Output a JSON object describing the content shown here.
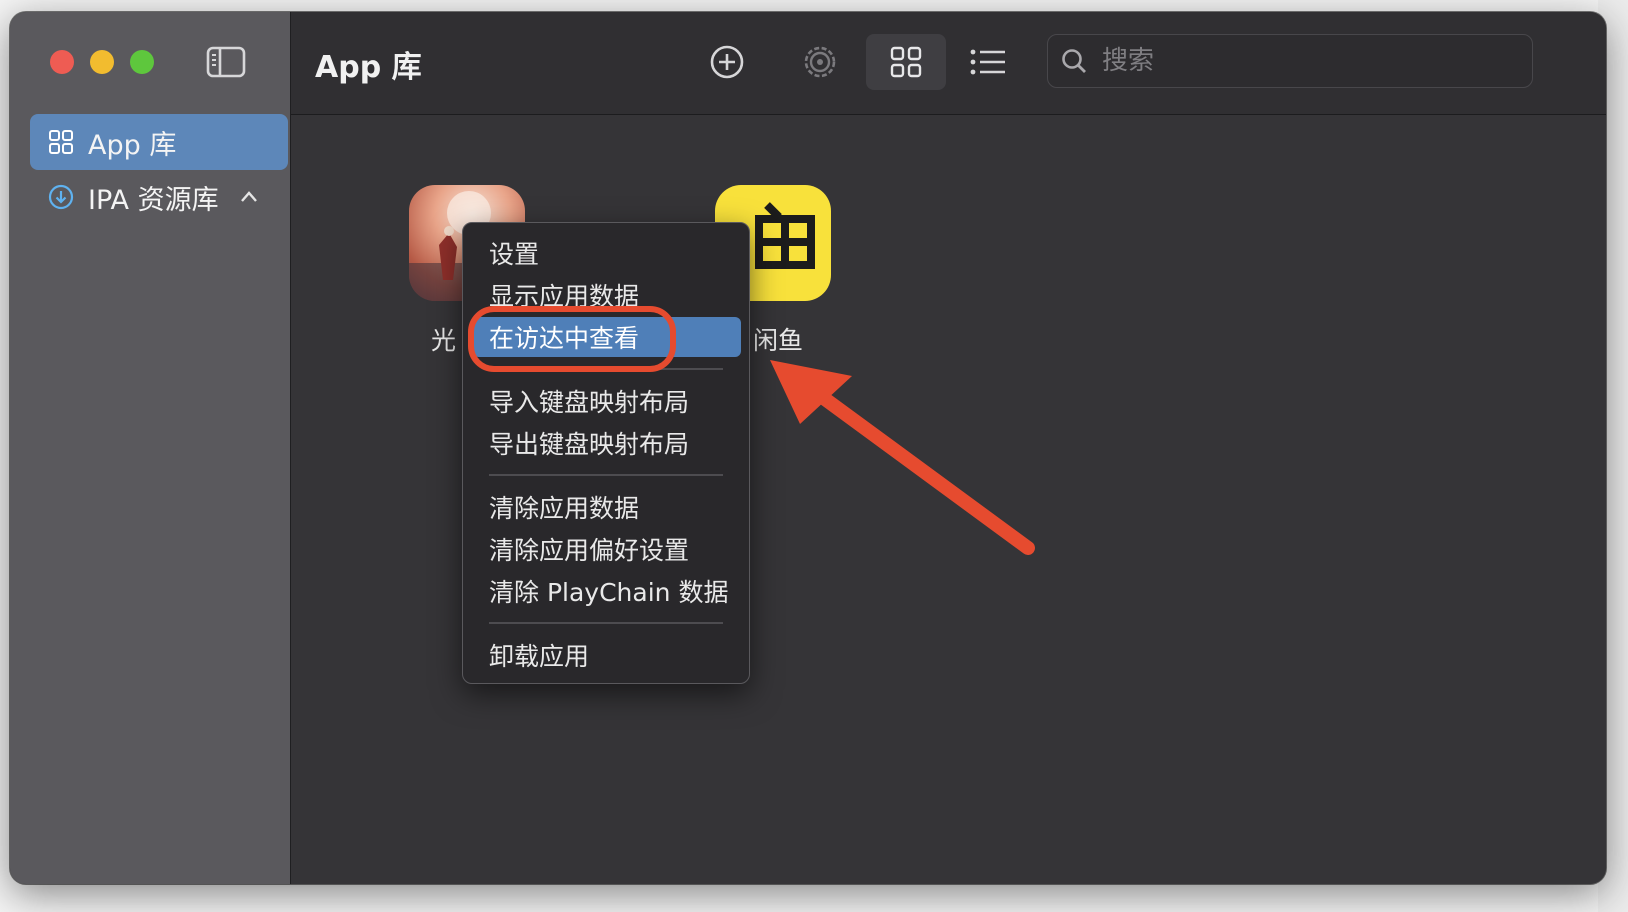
{
  "window": {
    "title": "App 库"
  },
  "sidebar": {
    "items": [
      {
        "label": "App 库",
        "icon": "grid-icon",
        "active": true
      },
      {
        "label": "IPA 资源库",
        "icon": "download-circle-icon",
        "expanded": true
      }
    ]
  },
  "toolbar": {
    "title": "App 库",
    "buttons": [
      "plus-circle-icon",
      "gear-icon",
      "grid-view-icon",
      "list-view-icon"
    ],
    "active_view": "grid"
  },
  "search": {
    "placeholder": "搜索",
    "value": ""
  },
  "apps": [
    {
      "label": "光 ·",
      "icon": "sky-app-icon"
    },
    {
      "label": "闲鱼",
      "icon": "xianyu-app-icon"
    }
  ],
  "context_menu": {
    "items": [
      {
        "label": "设置"
      },
      {
        "label": "显示应用数据"
      },
      {
        "label": "在访达中查看",
        "highlighted": true
      },
      {
        "label": "导入键盘映射布局"
      },
      {
        "label": "导出键盘映射布局"
      },
      {
        "label": "清除应用数据"
      },
      {
        "label": "清除应用偏好设置"
      },
      {
        "label": "清除 PlayChain 数据"
      },
      {
        "label": "卸载应用"
      }
    ]
  },
  "colors": {
    "accent": "#5d87b9",
    "menu_highlight": "#4f7fb8",
    "annotation": "#e64b2f",
    "traffic_red": "#ee5c53",
    "traffic_yellow": "#f2bc2f",
    "traffic_green": "#5ec73d"
  }
}
